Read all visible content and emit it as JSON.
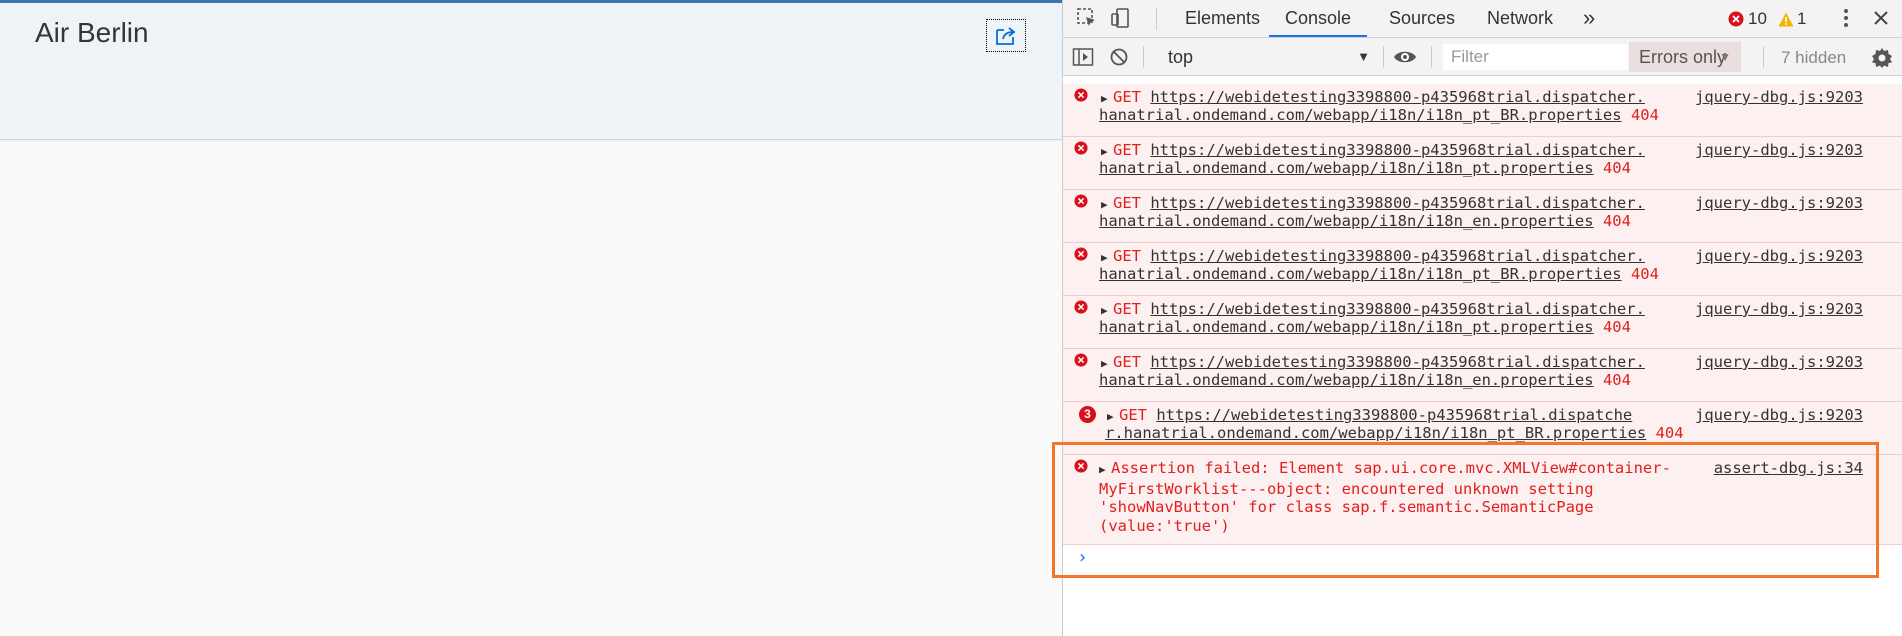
{
  "app": {
    "title": "Air Berlin",
    "share_icon": "share-icon"
  },
  "devtools": {
    "tabs": [
      "Elements",
      "Console",
      "Sources",
      "Network"
    ],
    "active_tab": "Console",
    "more_tabs": "»",
    "error_count": "10",
    "warning_count": "1",
    "toolbar": {
      "context": "top",
      "filter_placeholder": "Filter",
      "levels": "Errors only",
      "hidden": "7 hidden"
    },
    "messages": [
      {
        "method": "GET",
        "url_line1": "https://webidetesting3398800-p435968trial.dispatcher.",
        "url_line2": "hanatrial.ondemand.com/webapp/i18n/i18n_pt_BR.properties",
        "status": "404",
        "source": "jquery-dbg.js:9203"
      },
      {
        "method": "GET",
        "url_line1": "https://webidetesting3398800-p435968trial.dispatcher.",
        "url_line2": "hanatrial.ondemand.com/webapp/i18n/i18n_pt.properties",
        "status": "404",
        "source": "jquery-dbg.js:9203"
      },
      {
        "method": "GET",
        "url_line1": "https://webidetesting3398800-p435968trial.dispatcher.",
        "url_line2": "hanatrial.ondemand.com/webapp/i18n/i18n_en.properties",
        "status": "404",
        "source": "jquery-dbg.js:9203"
      },
      {
        "method": "GET",
        "url_line1": "https://webidetesting3398800-p435968trial.dispatcher.",
        "url_line2": "hanatrial.ondemand.com/webapp/i18n/i18n_pt_BR.properties",
        "status": "404",
        "source": "jquery-dbg.js:9203"
      },
      {
        "method": "GET",
        "url_line1": "https://webidetesting3398800-p435968trial.dispatcher.",
        "url_line2": "hanatrial.ondemand.com/webapp/i18n/i18n_pt.properties",
        "status": "404",
        "source": "jquery-dbg.js:9203"
      },
      {
        "method": "GET",
        "url_line1": "https://webidetesting3398800-p435968trial.dispatcher.",
        "url_line2": "hanatrial.ondemand.com/webapp/i18n/i18n_en.properties",
        "status": "404",
        "source": "jquery-dbg.js:9203"
      }
    ],
    "grouped_message": {
      "repeat": "3",
      "method": "GET",
      "url_line1": "https://webidetesting3398800-p435968trial.dispatche",
      "url_line2": "r.hanatrial.ondemand.com/webapp/i18n/i18n_pt_BR.properties",
      "status": "404",
      "source": "jquery-dbg.js:9203"
    },
    "assertion": {
      "text": "Assertion failed: Element sap.ui.core.mvc.XMLView#container-MyFirstWorklist---object: encountered unknown setting 'showNavButton' for class sap.f.semantic.SemanticPage (value:'true')",
      "source": "assert-dbg.js:34"
    },
    "prompt_caret": "›",
    "highlight_color": "#f0782c"
  }
}
